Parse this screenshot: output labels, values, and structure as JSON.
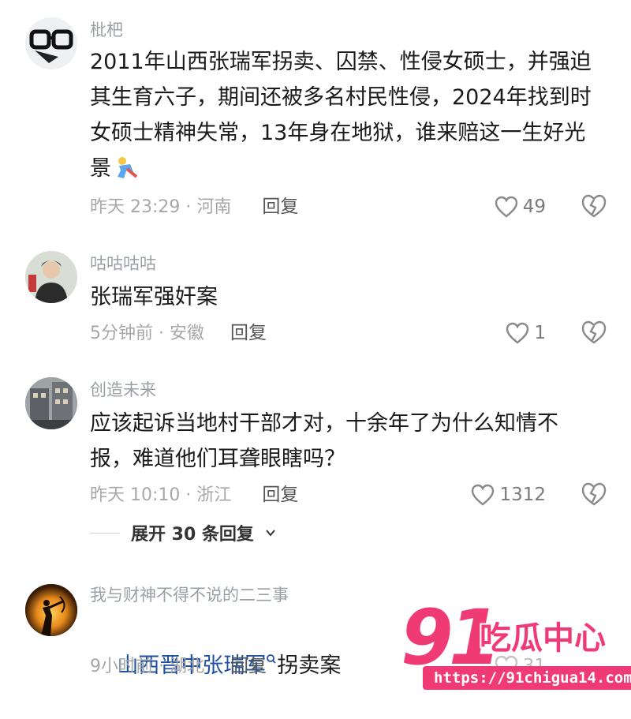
{
  "comments": [
    {
      "username": "枇杷",
      "text": "2011年山西张瑞军拐卖、囚禁、性侵女硕士，并强迫其生育六子，期间还被多名村民性侵，2024年找到时女硕士精神失常，13年身在地狱，谁来赔这一生好光景",
      "time_location": "昨天 23:29 · 河南",
      "reply_label": "回复",
      "likes": "49",
      "avatar": "glasses-avatar"
    },
    {
      "username": "咕咕咕咕",
      "text": "张瑞军强奸案",
      "time_location": "5分钟前 · 安徽",
      "reply_label": "回复",
      "likes": "1",
      "avatar": "person-avatar"
    },
    {
      "username": "创造未来",
      "text": "应该起诉当地村干部才对，十余年了为什么知情不报，难道他们耳聋眼瞎吗？",
      "time_location": "昨天 10:10 · 浙江",
      "reply_label": "回复",
      "likes": "1312",
      "avatar": "building-avatar"
    },
    {
      "username": "我与财神不得不说的二三事",
      "text_link": "山西晋中张瑞军",
      "text_rest": "拐卖案",
      "time_location": "9小时前 · 湖北",
      "reply_label": "回复",
      "likes": "31",
      "avatar": "sunset-avatar"
    }
  ],
  "expand_replies": "展开 30 条回复",
  "watermark": {
    "number": "91",
    "brand": "吃瓜中心",
    "url": "https://91chigua14.com"
  },
  "colors": {
    "link": "#1d4fa3",
    "watermark": "#f03a75",
    "meta": "#a7a7a7"
  }
}
